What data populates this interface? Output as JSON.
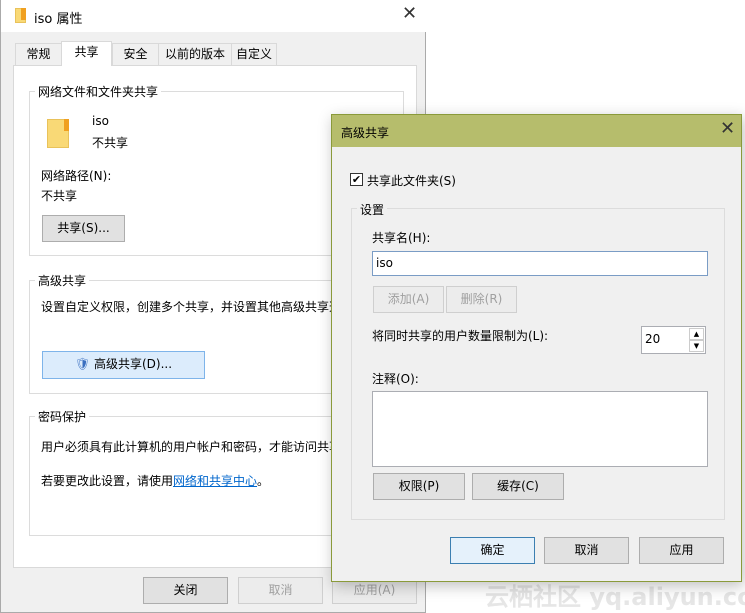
{
  "main_window": {
    "title": "iso 属性",
    "tabs": [
      {
        "label": "常规"
      },
      {
        "label": "共享",
        "selected": true
      },
      {
        "label": "安全"
      },
      {
        "label": "以前的版本"
      },
      {
        "label": "自定义"
      }
    ],
    "network_sharing": {
      "group_label": "网络文件和文件夹共享",
      "folder_name": "iso",
      "share_status": "不共享",
      "path_label": "网络路径(N):",
      "path_value": "不共享",
      "share_button": "共享(S)..."
    },
    "advanced_sharing": {
      "group_label": "高级共享",
      "description": "设置自定义权限，创建多个共享，并设置其他高级共享选",
      "button": "高级共享(D)..."
    },
    "password_protection": {
      "group_label": "密码保护",
      "description": "用户必须具有此计算机的用户帐户和密码，才能访问共享",
      "change_prefix": "若要更改此设置，请使用",
      "link": "网络和共享中心",
      "change_suffix": "。"
    },
    "buttons": {
      "close": "关闭",
      "cancel": "取消",
      "apply": "应用(A)"
    }
  },
  "dialog": {
    "title": "高级共享",
    "share_checkbox": {
      "label": "共享此文件夹(S)",
      "checked": true
    },
    "settings_group": "设置",
    "share_name_label": "共享名(H):",
    "share_name_value": "iso",
    "add_button": "添加(A)",
    "remove_button": "删除(R)",
    "limit_label": "将同时共享的用户数量限制为(L):",
    "limit_value": "20",
    "comment_label": "注释(O):",
    "comment_value": "",
    "permissions_button": "权限(P)",
    "caching_button": "缓存(C)",
    "ok": "确定",
    "cancel": "取消",
    "apply": "应用"
  },
  "watermark": "云栖社区 yq.aliyun.com",
  "colors": {
    "dialog_titlebar": "#b6bd6c",
    "link": "#0066cc"
  }
}
